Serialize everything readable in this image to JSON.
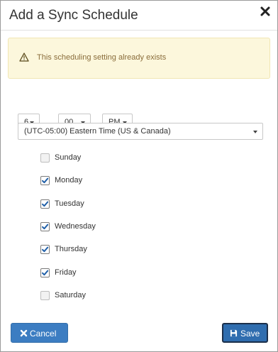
{
  "dialog": {
    "title": "Add a Sync Schedule",
    "close_icon": "close-icon"
  },
  "alert": {
    "icon": "warning-icon",
    "message": "This scheduling setting already exists"
  },
  "time": {
    "hour": "6",
    "minute": "00",
    "ampm": "PM",
    "timezone": "(UTC-05:00) Eastern Time (US & Canada)"
  },
  "days": [
    {
      "label": "Sunday",
      "checked": false
    },
    {
      "label": "Monday",
      "checked": true
    },
    {
      "label": "Tuesday",
      "checked": true
    },
    {
      "label": "Wednesday",
      "checked": true
    },
    {
      "label": "Thursday",
      "checked": true
    },
    {
      "label": "Friday",
      "checked": true
    },
    {
      "label": "Saturday",
      "checked": false
    }
  ],
  "buttons": {
    "cancel_label": "Cancel",
    "save_label": "Save"
  },
  "colors": {
    "alert_bg": "#fcf7dc",
    "alert_text": "#8a6d3b",
    "button_blue": "#3c7dc2",
    "checkmark": "#1f5fa8"
  }
}
